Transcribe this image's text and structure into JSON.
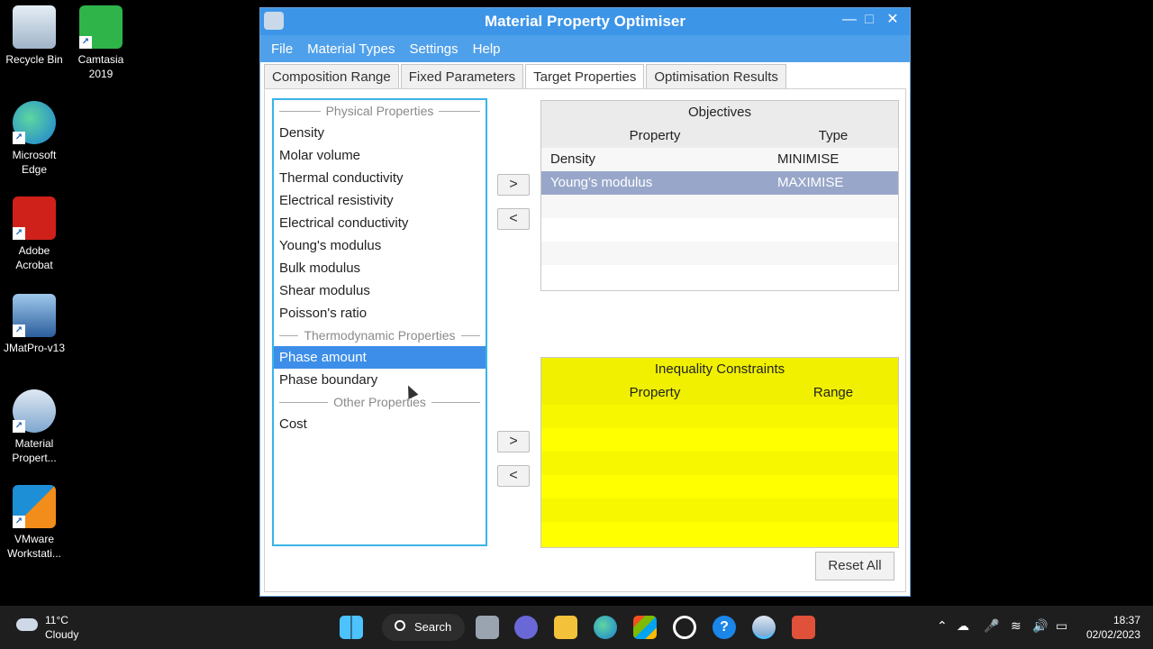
{
  "desktop": {
    "icons": [
      {
        "label": "Recycle Bin",
        "icon": "recycle-bin-icon"
      },
      {
        "label": "Camtasia 2019",
        "icon": "camtasia-icon"
      },
      {
        "label": "Microsoft Edge",
        "icon": "edge-icon"
      },
      {
        "label": "Adobe Acrobat",
        "icon": "acrobat-icon"
      },
      {
        "label": "JMatPro-v13",
        "icon": "jmatpro-icon"
      },
      {
        "label": "Material Propert...",
        "icon": "material-property-icon"
      },
      {
        "label": "VMware Workstati...",
        "icon": "vmware-icon"
      }
    ]
  },
  "window": {
    "title": "Material Property Optimiser",
    "controls": {
      "minimize": "—",
      "maximize": "□",
      "close": "✕"
    },
    "menu": [
      "File",
      "Material Types",
      "Settings",
      "Help"
    ],
    "tabs": [
      "Composition Range",
      "Fixed Parameters",
      "Target Properties",
      "Optimisation Results"
    ],
    "active_tab": "Target Properties"
  },
  "property_list": {
    "groups": [
      {
        "header": "Physical Properties",
        "items": [
          "Density",
          "Molar volume",
          "Thermal conductivity",
          "Electrical resistivity",
          "Electrical conductivity",
          "Young's modulus",
          "Bulk modulus",
          "Shear modulus",
          "Poisson's ratio"
        ]
      },
      {
        "header": "Thermodynamic Properties",
        "items": [
          "Phase amount",
          "Phase boundary"
        ]
      },
      {
        "header": "Other Properties",
        "items": [
          "Cost"
        ]
      }
    ],
    "selected": "Phase amount"
  },
  "arrows": {
    "add": ">",
    "remove": "<"
  },
  "objectives": {
    "title": "Objectives",
    "columns": [
      "Property",
      "Type"
    ],
    "rows": [
      {
        "property": "Density",
        "type": "MINIMISE"
      },
      {
        "property": "Young's modulus",
        "type": "MAXIMISE"
      }
    ],
    "selected_row": "Young's modulus"
  },
  "constraints": {
    "title": "Inequality Constraints",
    "columns": [
      "Property",
      "Range"
    ]
  },
  "reset_label": "Reset All",
  "taskbar": {
    "weather_temp": "11°C",
    "weather_desc": "Cloudy",
    "search_label": "Search",
    "time": "18:37",
    "date": "02/02/2023"
  },
  "colors": {
    "accent": "#3d95e8",
    "selection": "#3d8ee8",
    "constraints_bg": "#ffff00"
  }
}
